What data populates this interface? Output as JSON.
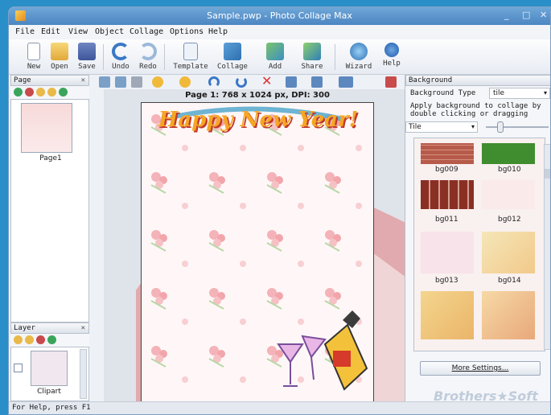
{
  "window": {
    "title": "Sample.pwp - Photo Collage Max",
    "minimize": "_",
    "maximize": "□",
    "close": "✕"
  },
  "menu": [
    "File",
    "Edit",
    "View",
    "Object",
    "Collage",
    "Options",
    "Help"
  ],
  "toolbar": [
    "New",
    "Open",
    "Save",
    "Undo",
    "Redo",
    "Template",
    "Collage",
    "Add",
    "Share",
    "Wizard",
    "Help"
  ],
  "page_panel": {
    "title": "Page",
    "page_label": "Page1"
  },
  "layer_panel": {
    "title": "Layer",
    "layer_label": "Clipart"
  },
  "canvas": {
    "page_info": "Page 1: 768 x 1024 px, DPI: 300",
    "greeting": "Happy New Year!"
  },
  "background_panel": {
    "title": "Background",
    "type_label": "Background Type",
    "type_value": "tile",
    "hint": "Apply background to collage by double clicking or dragging",
    "mode_value": "Tile",
    "thumbnails": [
      "bg009",
      "bg010",
      "bg011",
      "bg012",
      "bg013",
      "bg014"
    ],
    "more_button": "More Settings..."
  },
  "status": {
    "text": "For Help, press F1"
  },
  "watermark": "Brothers★Soft",
  "colors": {
    "accent": "#2a8fc8",
    "title_bar": "#4c86c2"
  }
}
